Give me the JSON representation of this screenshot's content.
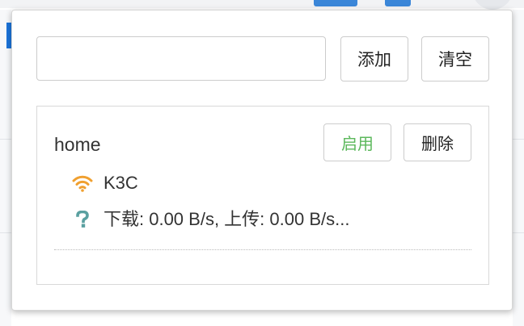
{
  "popup": {
    "input": {
      "value": "",
      "placeholder": ""
    },
    "add_label": "添加",
    "clear_label": "清空",
    "profile": {
      "name": "home",
      "enable_label": "启用",
      "delete_label": "删除",
      "ssid": "K3C",
      "speed": "下载: 0.00 B/s, 上传: 0.00 B/s..."
    },
    "icons": {
      "wifi": "wifi-icon",
      "unknown": "question-icon"
    }
  },
  "colors": {
    "enable_text": "#5cb85c",
    "wifi_icon": "#f0a030",
    "question_icon": "#5aa0a0"
  }
}
